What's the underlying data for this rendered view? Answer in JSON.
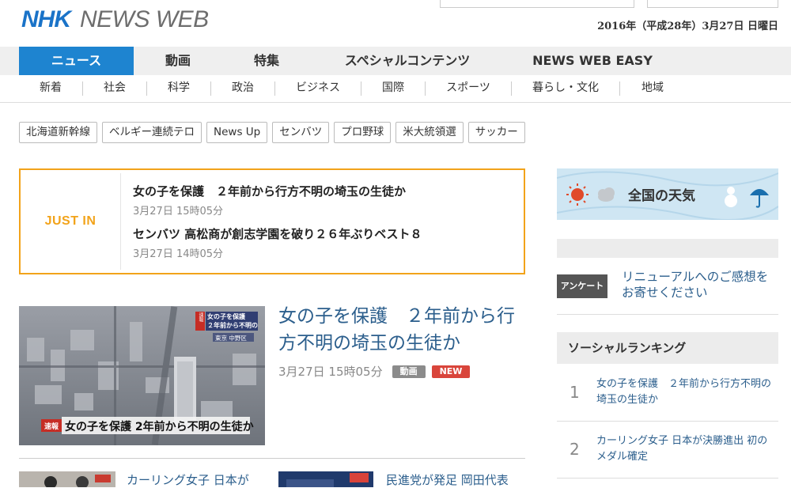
{
  "header": {
    "logo_nhk": "NHK",
    "logo_newsweb": "NEWS WEB",
    "date": "2016年（平成28年）3月27日 日曜日"
  },
  "main_nav": [
    {
      "label": "ニュース",
      "active": true
    },
    {
      "label": "動画"
    },
    {
      "label": "特集"
    },
    {
      "label": "スペシャルコンテンツ"
    },
    {
      "label": "NEWS WEB EASY"
    }
  ],
  "sub_nav": [
    "新着",
    "社会",
    "科学",
    "政治",
    "ビジネス",
    "国際",
    "スポーツ",
    "暮らし・文化",
    "地域"
  ],
  "tags": [
    "北海道新幹線",
    "ベルギー連続テロ",
    "News Up",
    "センバツ",
    "プロ野球",
    "米大統領選",
    "サッカー"
  ],
  "just_in": {
    "label": "JUST IN",
    "items": [
      {
        "title": "女の子を保護　２年前から行方不明の埼玉の生徒か",
        "time": "3月27日 15時05分"
      },
      {
        "title": "センバツ 高松商が創志学園を破り２６年ぶりベスト８",
        "time": "3月27日 14時05分"
      }
    ]
  },
  "main_article": {
    "title": "女の子を保護　２年前から行方不明の埼玉の生徒か",
    "time": "3月27日 15時05分",
    "badge_video": "動画",
    "badge_new": "NEW",
    "image": {
      "breaking_tag_top": "速報",
      "caption_top_1": "女の子を保護",
      "caption_top_2": "２年前から不明の",
      "location": "東京 中野区",
      "breaking_tag_bottom": "速報",
      "caption_bottom": "女の子を保護 2年前から不明の生徒か"
    }
  },
  "sub_articles": [
    {
      "title": "カーリング女子 日本が"
    },
    {
      "title": "民進党が発足 岡田代表"
    }
  ],
  "sidebar": {
    "weather_title": "全国の天気",
    "survey_badge": "アンケート",
    "survey_text": "リニューアルへのご感想をお寄せください",
    "ranking_title": "ソーシャルランキング",
    "ranking": [
      {
        "rank": "1",
        "title": "女の子を保護　２年前から行方不明の埼玉の生徒か"
      },
      {
        "rank": "2",
        "title": "カーリング女子 日本が決勝進出 初のメダル確定"
      }
    ]
  },
  "colors": {
    "brand_blue": "#1e84d0",
    "justin_orange": "#f2a31a",
    "link_blue": "#2b5e8c",
    "new_red": "#d9453b"
  }
}
